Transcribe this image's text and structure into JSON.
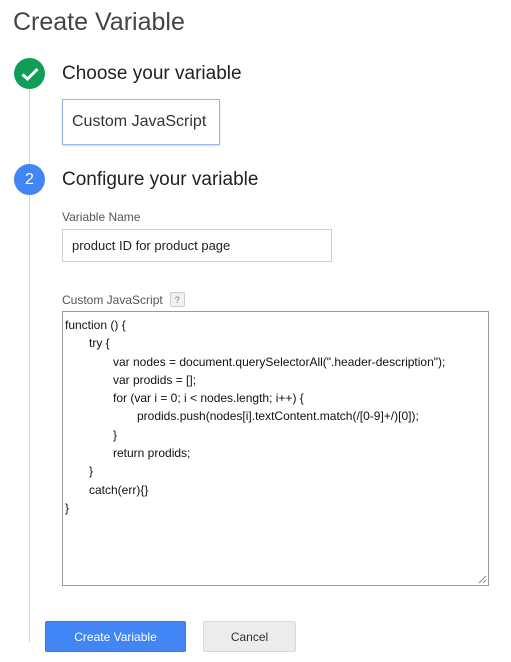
{
  "page": {
    "title": "Create Variable"
  },
  "steps": [
    {
      "status": "done",
      "title": "Choose your variable"
    },
    {
      "number": "2",
      "title": "Configure your variable"
    }
  ],
  "variable_type": {
    "label": "Custom JavaScript"
  },
  "form": {
    "name_label": "Variable Name",
    "name_value": "product ID for product page",
    "js_label": "Custom JavaScript",
    "help_glyph": "?",
    "js_code": "function () {\n\ttry {\n\t\tvar nodes = document.querySelectorAll(\".header-description\");\n\t\tvar prodids = [];\n\t\tfor (var i = 0; i < nodes.length; i++) {\n\t\t\tprodids.push(nodes[i].textContent.match(/[0-9]+/)[0]);\n\t\t}\n\t\treturn prodids;\n\t}\n\tcatch(err){}\n}"
  },
  "actions": {
    "primary_label": "Create Variable",
    "secondary_label": "Cancel"
  },
  "colors": {
    "done": "#0f9d58",
    "step_active": "#4285f4",
    "primary_button": "#4285f4",
    "card_border": "#9ab7ec"
  },
  "icons": {
    "step_done": "checkmark-icon",
    "help": "help-icon",
    "resize": "resize-handle-icon"
  }
}
